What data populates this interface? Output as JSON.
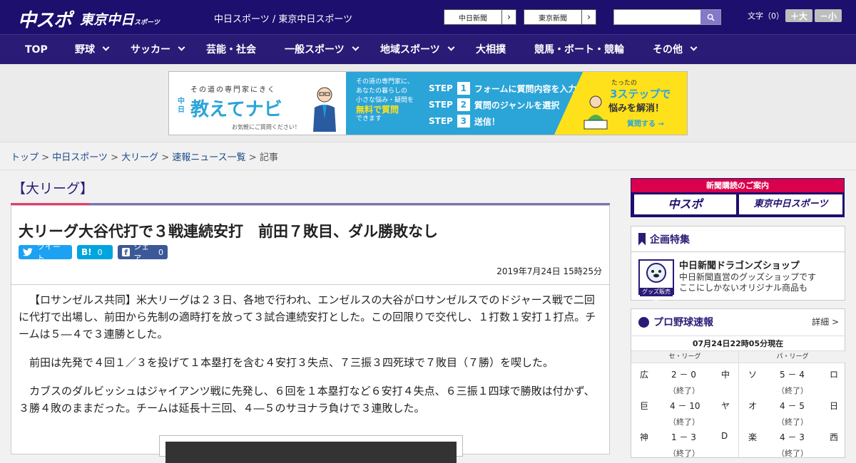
{
  "header": {
    "logo_chuspo": "中スポ",
    "logo_tokyo": "東京中日",
    "logo_tokyo_small": "スポーツ",
    "site_title": "中日スポーツ / 東京中日スポーツ",
    "paper_buttons": [
      "中日新聞",
      "東京新聞"
    ],
    "search_placeholder": "",
    "font_label": "文字（0）",
    "font_bigger": "＋大",
    "font_smaller": "－小"
  },
  "nav": {
    "items": [
      {
        "label": "TOP",
        "dropdown": false
      },
      {
        "label": "野球",
        "dropdown": true
      },
      {
        "label": "サッカー",
        "dropdown": true
      },
      {
        "label": "芸能・社会",
        "dropdown": false
      },
      {
        "label": "一般スポーツ",
        "dropdown": true
      },
      {
        "label": "地域スポーツ",
        "dropdown": true
      },
      {
        "label": "大相撲",
        "dropdown": false
      },
      {
        "label": "競馬・ボート・競輪",
        "dropdown": false
      },
      {
        "label": "その他",
        "dropdown": true
      }
    ]
  },
  "ad": {
    "sub": "その道の専門家にきく",
    "brand_small": "中日",
    "title": "教えてナビ",
    "note": "お気軽にご質問ください！",
    "mid_lines": [
      "その道の専門家に、",
      "あなたの暮らしの",
      "小さな悩み・疑問を"
    ],
    "mid_highlight": "無料で質問",
    "mid_tail": "できます",
    "steps": [
      {
        "label": "STEP",
        "num": "1",
        "text": "フォームに質問内容を入力"
      },
      {
        "label": "STEP",
        "num": "2",
        "text": "質問のジャンルを選択"
      },
      {
        "label": "STEP",
        "num": "3",
        "text": "送信！"
      }
    ],
    "right_1": "たったの",
    "right_2": "3ステップで",
    "right_3": "悩みを解消！",
    "right_4": "質問する →"
  },
  "breadcrumb": {
    "links": [
      "トップ",
      "中日スポーツ",
      "大リーグ",
      "速報ニュース一覧"
    ],
    "current": "記事",
    "sep": " > "
  },
  "category": "【大リーグ】",
  "article": {
    "headline": "大リーグ大谷代打で３戦連続安打　前田７敗目、ダル勝敗なし",
    "tweet_label": "ツイート",
    "hatena_label": "B!",
    "hatena_count": "0",
    "share_label": "シェア",
    "share_count": "0",
    "date": "2019年7月24日 15時25分",
    "paragraphs": [
      "【ロサンゼルス共同】米大リーグは２３日、各地で行われ、エンゼルスの大谷がロサンゼルスでのドジャース戦で二回に代打で出場し、前田から先制の適時打を放って３試合連続安打とした。この回限りで交代し、１打数１安打１打点。チームは５―４で３連勝とした。",
      "前田は先発で４回１／３を投げて１本塁打を含む４安打３失点、７三振３四死球で７敗目（７勝）を喫した。",
      "カブスのダルビッシュはジャイアンツ戦に先発し、６回を１本塁打など６安打４失点、６三振１四球で勝敗は付かず、３勝４敗のままだった。チームは延長十三回、４―５のサヨナラ負けで３連敗した。"
    ]
  },
  "sidebar": {
    "subscribe_header": "新聞購読のご案内",
    "subscribe_buttons": [
      "中スポ",
      "東京中日スポーツ"
    ],
    "feature": {
      "title": "企画特集",
      "shop_title": "中日新聞ドラゴンズショップ",
      "shop_lines": [
        "中日新聞直営のグッズショップです",
        "ここにしかないオリジナル商品も"
      ],
      "shop_badge": "グッズ販売中"
    },
    "baseball": {
      "title": "プロ野球速報",
      "detail": "詳細 >",
      "as_of": "07月24日22時05分現在",
      "central_label": "セ・リーグ",
      "pacific_label": "パ・リーグ",
      "central": [
        {
          "home": "広",
          "score": "2 － 0",
          "away": "中",
          "status": "（終了）"
        },
        {
          "home": "巨",
          "score": "4 － 10",
          "away": "ヤ",
          "status": "（終了）"
        },
        {
          "home": "神",
          "score": "1 － 3",
          "away": "D",
          "status": "（終了）"
        }
      ],
      "pacific": [
        {
          "home": "ソ",
          "score": "5 － 4",
          "away": "ロ",
          "status": "（終了）"
        },
        {
          "home": "オ",
          "score": "4 － 5",
          "away": "日",
          "status": "（終了）"
        },
        {
          "home": "楽",
          "score": "4 － 3",
          "away": "西",
          "status": "（終了）"
        }
      ]
    }
  },
  "colors": {
    "header_bg": "#1c0f6e",
    "nav_bg": "#2a1b76",
    "accent_pink": "#e33d6e",
    "twitter": "#1da1f2",
    "hatena": "#00a4de",
    "facebook": "#3b5998"
  }
}
